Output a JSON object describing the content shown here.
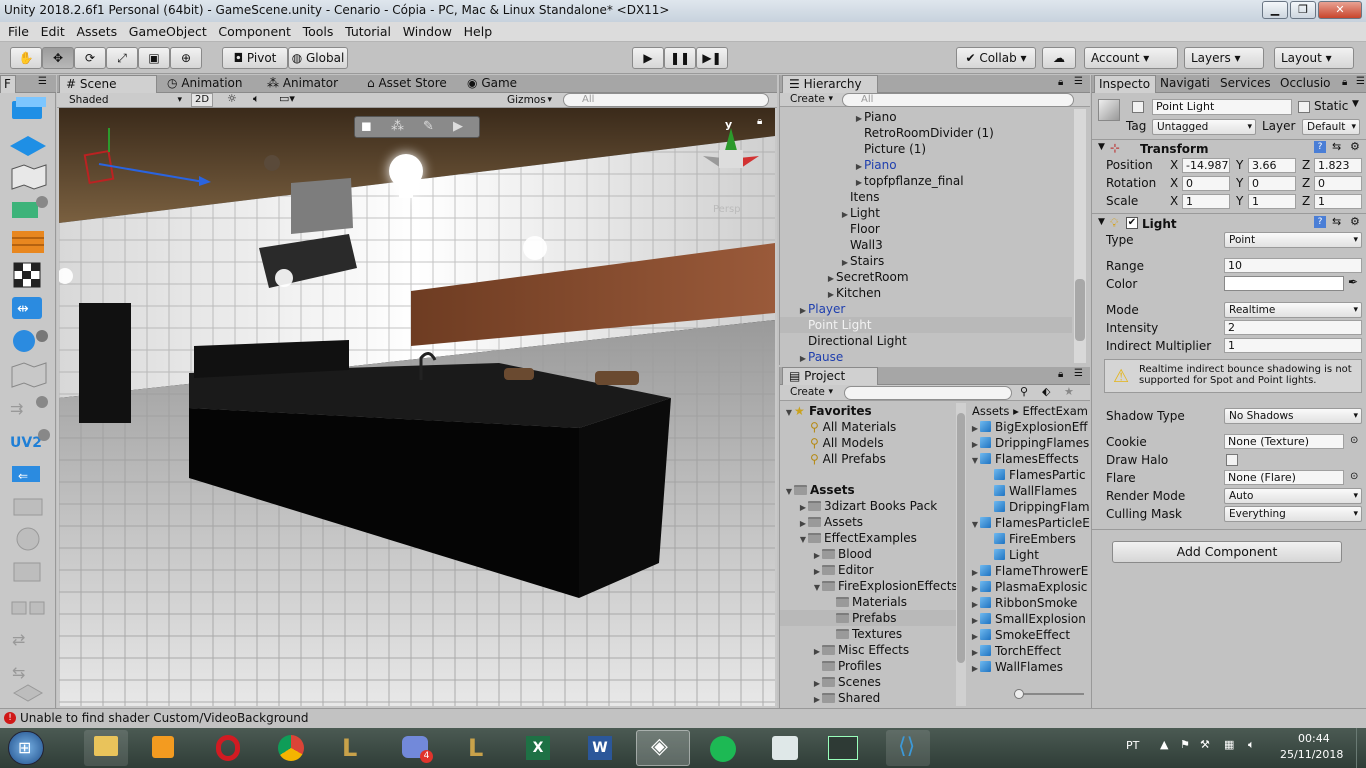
{
  "window": {
    "title": "Unity 2018.2.6f1 Personal (64bit) - GameScene.unity - Cenario - Cópia - PC, Mac & Linux Standalone* <DX11>",
    "minimize": "▁",
    "maximize": "❐",
    "close": "✕"
  },
  "menu": [
    "File",
    "Edit",
    "Assets",
    "GameObject",
    "Component",
    "Tools",
    "Tutorial",
    "Window",
    "Help"
  ],
  "toolbar": {
    "pivot": "Pivot",
    "global": "Global",
    "collab": "Collab",
    "account": "Account",
    "layers": "Layers",
    "layout": "Layout"
  },
  "left_panel": {
    "tab": "F"
  },
  "scene": {
    "tabs": [
      "Scene",
      "Animation",
      "Animator",
      "Asset Store",
      "Game"
    ],
    "shading": "Shaded",
    "mode_2d": "2D",
    "gizmos": "Gizmos",
    "search_placeholder": "All",
    "persp_label": "Persp",
    "axis_y": "y"
  },
  "hierarchy": {
    "tab": "Hierarchy",
    "create": "Create",
    "search_placeholder": "All",
    "items": [
      {
        "label": "Piano",
        "depth": 5,
        "arrow": "▶",
        "style": "normal"
      },
      {
        "label": "RetroRoomDivider (1)",
        "depth": 5,
        "arrow": "",
        "style": "normal"
      },
      {
        "label": "Picture (1)",
        "depth": 5,
        "arrow": "",
        "style": "normal"
      },
      {
        "label": "Piano",
        "depth": 5,
        "arrow": "▶",
        "style": "prefab"
      },
      {
        "label": "topfpflanze_final",
        "depth": 5,
        "arrow": "▶",
        "style": "normal"
      },
      {
        "label": "Itens",
        "depth": 4,
        "arrow": "",
        "style": "normal"
      },
      {
        "label": "Light",
        "depth": 4,
        "arrow": "▶",
        "style": "normal"
      },
      {
        "label": "Floor",
        "depth": 4,
        "arrow": "",
        "style": "normal"
      },
      {
        "label": "Wall3",
        "depth": 4,
        "arrow": "",
        "style": "normal"
      },
      {
        "label": "Stairs",
        "depth": 4,
        "arrow": "▶",
        "style": "normal"
      },
      {
        "label": "SecretRoom",
        "depth": 3,
        "arrow": "▶",
        "style": "normal"
      },
      {
        "label": "Kitchen",
        "depth": 3,
        "arrow": "▶",
        "style": "normal"
      },
      {
        "label": "Player",
        "depth": 1,
        "arrow": "▶",
        "style": "prefab"
      },
      {
        "label": "Point Light",
        "depth": 1,
        "arrow": "",
        "style": "selected"
      },
      {
        "label": "Directional Light",
        "depth": 1,
        "arrow": "",
        "style": "normal"
      },
      {
        "label": "Pause",
        "depth": 1,
        "arrow": "▶",
        "style": "prefab"
      }
    ]
  },
  "project": {
    "tab": "Project",
    "create": "Create",
    "favorites_title": "Favorites",
    "favorites": [
      "All Materials",
      "All Models",
      "All Prefabs"
    ],
    "assets_title": "Assets",
    "tree": [
      {
        "label": "3dizart Books Pack",
        "depth": 1,
        "arrow": "▶",
        "selected": false
      },
      {
        "label": "Assets",
        "depth": 1,
        "arrow": "▶",
        "selected": false
      },
      {
        "label": "EffectExamples",
        "depth": 1,
        "arrow": "▼",
        "selected": false
      },
      {
        "label": "Blood",
        "depth": 2,
        "arrow": "▶",
        "selected": false
      },
      {
        "label": "Editor",
        "depth": 2,
        "arrow": "▶",
        "selected": false
      },
      {
        "label": "FireExplosionEffects",
        "depth": 2,
        "arrow": "▼",
        "selected": false
      },
      {
        "label": "Materials",
        "depth": 3,
        "arrow": "",
        "selected": false
      },
      {
        "label": "Prefabs",
        "depth": 3,
        "arrow": "",
        "selected": true
      },
      {
        "label": "Textures",
        "depth": 3,
        "arrow": "",
        "selected": false
      },
      {
        "label": "Misc Effects",
        "depth": 2,
        "arrow": "▶",
        "selected": false
      },
      {
        "label": "Profiles",
        "depth": 2,
        "arrow": "",
        "selected": false
      },
      {
        "label": "Scenes",
        "depth": 2,
        "arrow": "▶",
        "selected": false
      },
      {
        "label": "Shared",
        "depth": 2,
        "arrow": "▶",
        "selected": false
      }
    ],
    "breadcrumb": [
      "Assets",
      "EffectExam"
    ],
    "files": [
      {
        "label": "BigExplosionEff",
        "depth": 0,
        "arrow": "▶"
      },
      {
        "label": "DrippingFlames",
        "depth": 0,
        "arrow": "▶"
      },
      {
        "label": "FlamesEffects",
        "depth": 0,
        "arrow": "▼"
      },
      {
        "label": "FlamesPartic",
        "depth": 1,
        "arrow": ""
      },
      {
        "label": "WallFlames",
        "depth": 1,
        "arrow": ""
      },
      {
        "label": "DrippingFlam",
        "depth": 1,
        "arrow": ""
      },
      {
        "label": "FlamesParticleE",
        "depth": 0,
        "arrow": "▼"
      },
      {
        "label": "FireEmbers",
        "depth": 1,
        "arrow": ""
      },
      {
        "label": "Light",
        "depth": 1,
        "arrow": ""
      },
      {
        "label": "FlameThrowerE",
        "depth": 0,
        "arrow": "▶"
      },
      {
        "label": "PlasmaExplosic",
        "depth": 0,
        "arrow": "▶"
      },
      {
        "label": "RibbonSmoke",
        "depth": 0,
        "arrow": "▶"
      },
      {
        "label": "SmallExplosion",
        "depth": 0,
        "arrow": "▶"
      },
      {
        "label": "SmokeEffect",
        "depth": 0,
        "arrow": "▶"
      },
      {
        "label": "TorchEffect",
        "depth": 0,
        "arrow": "▶"
      },
      {
        "label": "WallFlames",
        "depth": 0,
        "arrow": "▶"
      }
    ]
  },
  "inspector": {
    "tabs": [
      "Inspecto",
      "Navigati",
      "Services",
      "Occlusio"
    ],
    "object_name": "Point Light",
    "static_label": "Static",
    "tag_label": "Tag",
    "tag_value": "Untagged",
    "layer_label": "Layer",
    "layer_value": "Default",
    "transform": {
      "title": "Transform",
      "position_label": "Position",
      "rotation_label": "Rotation",
      "scale_label": "Scale",
      "position": {
        "x": "-14.987",
        "y": "3.66",
        "z": "1.823"
      },
      "rotation": {
        "x": "0",
        "y": "0",
        "z": "0"
      },
      "scale": {
        "x": "1",
        "y": "1",
        "z": "1"
      }
    },
    "light": {
      "title": "Light",
      "type_label": "Type",
      "type": "Point",
      "range_label": "Range",
      "range": "10",
      "color_label": "Color",
      "mode_label": "Mode",
      "mode": "Realtime",
      "intensity_label": "Intensity",
      "intensity": "2",
      "indirect_label": "Indirect Multiplier",
      "indirect": "1",
      "warning": "Realtime indirect bounce shadowing is not supported for Spot and Point lights.",
      "shadow_label": "Shadow Type",
      "shadow": "No Shadows",
      "cookie_label": "Cookie",
      "cookie": "None (Texture)",
      "halo_label": "Draw Halo",
      "flare_label": "Flare",
      "flare": "None (Flare)",
      "render_label": "Render Mode",
      "render": "Auto",
      "culling_label": "Culling Mask",
      "culling": "Everything"
    },
    "add_component": "Add Component"
  },
  "status": {
    "message": "Unable to find shader Custom/VideoBackground"
  },
  "taskbar": {
    "lang": "PT",
    "time": "00:44",
    "date": "25/11/2018",
    "notification_badge": "4"
  },
  "colors": {
    "prefab_blue": "#1f3fae",
    "selected_row": "#b9b9b9",
    "error_red": "#d01818"
  }
}
